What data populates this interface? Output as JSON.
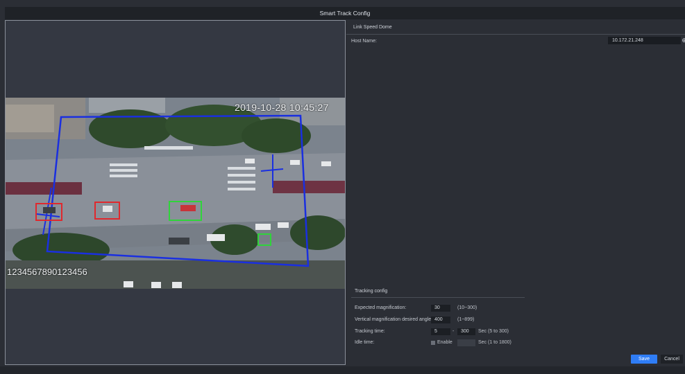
{
  "window": {
    "title": "Smart Track Config"
  },
  "video": {
    "timestamp": "2019-10-28 10:45:27",
    "channel_label": "1234567890123456"
  },
  "link": {
    "section_title": "Link Speed Dome",
    "host_name_label": "Host Name:",
    "host_name_value": "10.172.21.248",
    "host_button_icon": "⊕"
  },
  "tracking": {
    "section_title": "Tracking config",
    "expected_magnification": {
      "label": "Expected magnification:",
      "value": "30",
      "range": "(10~300)"
    },
    "vertical_angle": {
      "label": "Vertical magnification desired angle",
      "value": "400",
      "range": "(1~899)"
    },
    "tracking_time": {
      "label": "Tracking time:",
      "min": "5",
      "separator": "-",
      "max": "300",
      "unit": "Sec (5 to 300)"
    },
    "idle_time": {
      "label": "Idle time:",
      "enable_label": "Enable",
      "value": "",
      "unit": "Sec (1 to 1800)"
    }
  },
  "buttons": {
    "save": "Save",
    "cancel": "Cancel"
  },
  "colors": {
    "accent": "#2f7df6",
    "region_line": "#1a2fe0",
    "alarm_box": "#e0282d",
    "target_box": "#2fd43a"
  }
}
